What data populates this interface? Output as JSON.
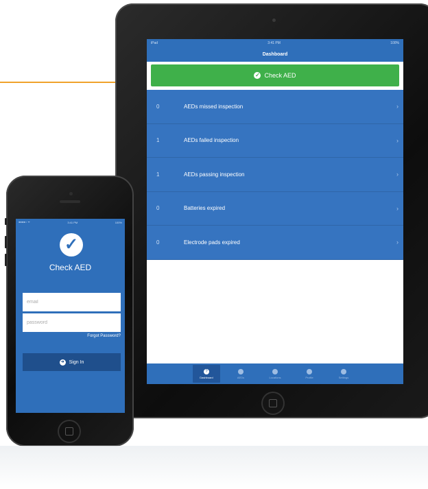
{
  "ipad": {
    "status": {
      "left": "iPad",
      "time": "3:41 PM",
      "battery": "100%"
    },
    "nav_title": "Dashboard",
    "check_button_label": "Check AED",
    "rows": [
      {
        "count": "0",
        "label": "AEDs missed inspection"
      },
      {
        "count": "1",
        "label": "AEDs failed inspection"
      },
      {
        "count": "1",
        "label": "AEDs passing inspection"
      },
      {
        "count": "0",
        "label": "Batteries expired"
      },
      {
        "count": "0",
        "label": "Electrode pads expired"
      }
    ],
    "tabs": [
      {
        "label": "Dashboard",
        "icon": "dashboard-icon"
      },
      {
        "label": "AEDs",
        "icon": "aed-icon"
      },
      {
        "label": "Locations",
        "icon": "location-icon"
      },
      {
        "label": "Profile",
        "icon": "profile-icon"
      },
      {
        "label": "Settings",
        "icon": "gear-icon"
      }
    ]
  },
  "iphone": {
    "status": {
      "left": "●●●●○ ᯤ",
      "time": "3:41 PM",
      "battery": "100%"
    },
    "app_title": "Check AED",
    "email_placeholder": "email",
    "password_placeholder": "password",
    "forgot_label": "Forgot Password?",
    "signin_label": "Sign In"
  },
  "colors": {
    "accent_orange": "#f0a22a",
    "app_blue": "#2f6fba",
    "row_blue": "#3674c0",
    "button_green": "#3fb04a",
    "signin_blue": "#1f4f8c"
  }
}
